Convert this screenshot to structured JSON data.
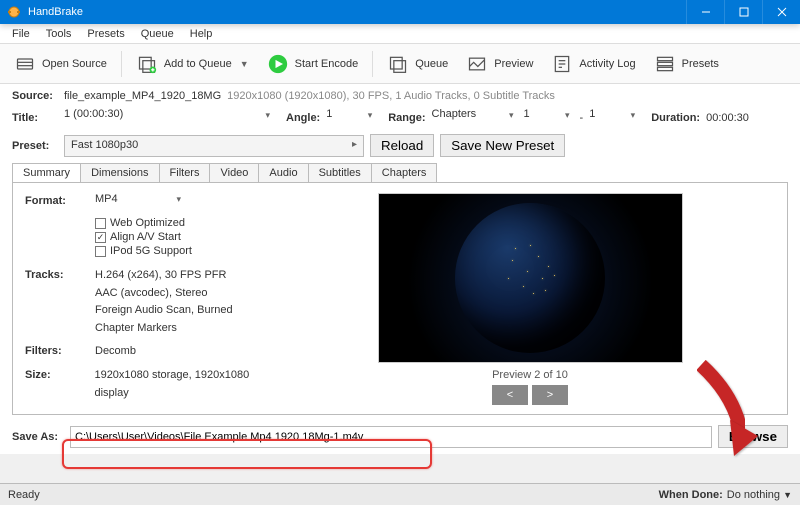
{
  "window": {
    "title": "HandBrake"
  },
  "menu": {
    "file": "File",
    "tools": "Tools",
    "presets": "Presets",
    "queue": "Queue",
    "help": "Help"
  },
  "toolbar": {
    "open_source": "Open Source",
    "add_to_queue": "Add to Queue",
    "start_encode": "Start Encode",
    "queue": "Queue",
    "preview": "Preview",
    "activity_log": "Activity Log",
    "presets": "Presets"
  },
  "source": {
    "label": "Source:",
    "name": "file_example_MP4_1920_18MG",
    "meta": "1920x1080 (1920x1080), 30 FPS, 1 Audio Tracks, 0 Subtitle Tracks"
  },
  "titlebar": {
    "title_label": "Title:",
    "title_value": "1  (00:00:30)",
    "angle_label": "Angle:",
    "angle_value": "1",
    "range_label": "Range:",
    "range_type": "Chapters",
    "range_from": "1",
    "dash": "-",
    "range_to": "1",
    "duration_label": "Duration:",
    "duration_value": "00:00:30"
  },
  "preset": {
    "label": "Preset:",
    "value": "Fast 1080p30",
    "reload": "Reload",
    "save_new": "Save New Preset"
  },
  "tabs": {
    "summary": "Summary",
    "dimensions": "Dimensions",
    "filters": "Filters",
    "video": "Video",
    "audio": "Audio",
    "subtitles": "Subtitles",
    "chapters": "Chapters"
  },
  "summary": {
    "format_label": "Format:",
    "format_value": "MP4",
    "web_optimized": "Web Optimized",
    "align_av": "Align A/V Start",
    "ipod_5g": "IPod 5G Support",
    "tracks_label": "Tracks:",
    "tracks_line1": "H.264 (x264), 30 FPS PFR",
    "tracks_line2": "AAC (avcodec), Stereo",
    "tracks_line3": "Foreign Audio Scan, Burned",
    "tracks_line4": "Chapter Markers",
    "filters_label": "Filters:",
    "filters_value": "Decomb",
    "size_label": "Size:",
    "size_value": "1920x1080 storage, 1920x1080 display",
    "preview_caption": "Preview 2 of 10",
    "prev": "<",
    "next": ">"
  },
  "saveas": {
    "label": "Save As:",
    "value": "C:\\Users\\User\\Videos\\File Example Mp4 1920 18Mg-1.m4v",
    "browse": "Browse"
  },
  "status": {
    "text": "Ready",
    "when_done_label": "When Done:",
    "when_done_value": "Do nothing"
  }
}
